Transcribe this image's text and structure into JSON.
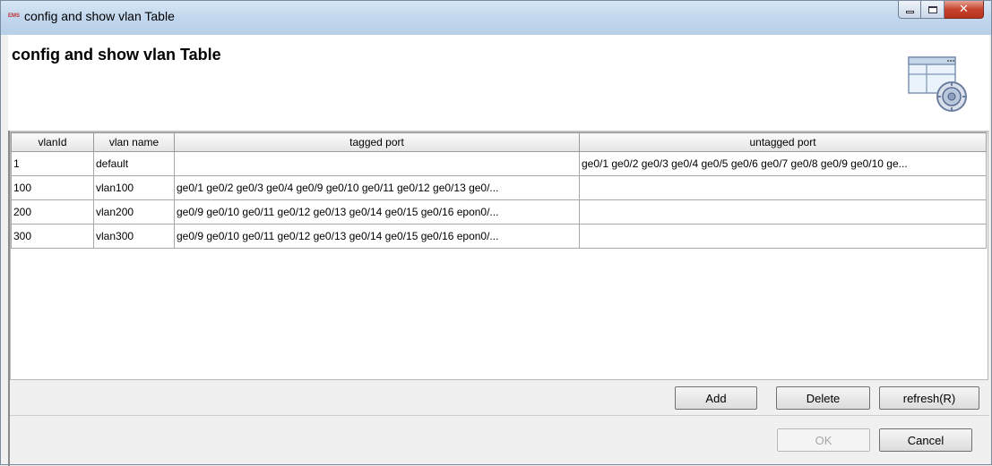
{
  "window": {
    "title": "config and show vlan Table",
    "app_badge": "EMS"
  },
  "header": {
    "heading": "config and show vlan Table"
  },
  "table": {
    "columns": [
      "vlanId",
      "vlan name",
      "tagged port",
      "untagged port"
    ],
    "rows": [
      [
        "1",
        "default",
        "",
        "ge0/1 ge0/2 ge0/3 ge0/4 ge0/5 ge0/6 ge0/7 ge0/8 ge0/9 ge0/10 ge..."
      ],
      [
        "100",
        "vlan100",
        "ge0/1 ge0/2 ge0/3 ge0/4 ge0/9 ge0/10 ge0/11 ge0/12 ge0/13 ge0/...",
        ""
      ],
      [
        "200",
        "vlan200",
        "ge0/9 ge0/10 ge0/11 ge0/12 ge0/13 ge0/14 ge0/15 ge0/16 epon0/...",
        ""
      ],
      [
        "300",
        "vlan300",
        "ge0/9 ge0/10 ge0/11 ge0/12 ge0/13 ge0/14 ge0/15 ge0/16 epon0/...",
        ""
      ]
    ]
  },
  "actions": {
    "add": "Add",
    "delete": "Delete",
    "refresh": "refresh(R)"
  },
  "footer": {
    "ok": "OK",
    "ok_enabled": false,
    "cancel": "Cancel"
  }
}
